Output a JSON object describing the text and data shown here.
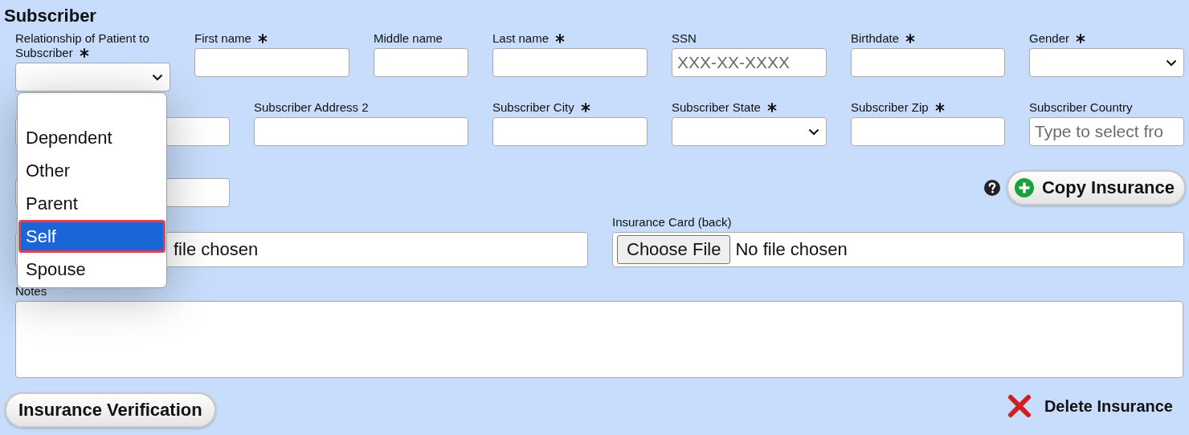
{
  "section_title": "Subscriber",
  "rows": [
    {
      "fields": [
        {
          "kind": "select",
          "label": "Relationship of Patient to Subscriber",
          "required": true,
          "expanded": true,
          "options": [
            {
              "kind": "option",
              "label": "Dependent",
              "selected": false
            },
            {
              "kind": "option",
              "label": "Other",
              "selected": false
            },
            {
              "kind": "option",
              "label": "Parent",
              "selected": false
            },
            {
              "kind": "option",
              "label": "Self",
              "selected": true
            },
            {
              "kind": "option",
              "label": "Spouse",
              "selected": false
            }
          ]
        },
        {
          "kind": "text",
          "label": "First name",
          "required": true
        },
        {
          "kind": "text",
          "label": "Middle name",
          "required": false
        },
        {
          "kind": "text",
          "label": "Last name",
          "required": true
        },
        {
          "kind": "text",
          "label": "SSN",
          "required": false,
          "placeholder": "XXX-XX-XXXX"
        },
        {
          "kind": "text",
          "label": "Birthdate",
          "required": true
        },
        {
          "kind": "select",
          "label": "Gender",
          "required": true,
          "expanded": false
        }
      ]
    },
    {
      "fields": [
        {
          "kind": "text"
        },
        {
          "kind": "text",
          "label": "Subscriber Address 2",
          "required": false
        },
        {
          "kind": "text",
          "label": "Subscriber City",
          "required": true
        },
        {
          "kind": "select",
          "label": "Subscriber State",
          "required": true,
          "expanded": false
        },
        {
          "kind": "text",
          "label": "Subscriber Zip",
          "required": true
        },
        {
          "kind": "text",
          "label": "Subscriber Country",
          "required": false,
          "placeholder": "Type to select fro"
        }
      ]
    },
    {
      "fields": [
        {
          "kind": "text"
        }
      ]
    }
  ],
  "copy_button": {
    "label": "Copy Insurance"
  },
  "file_fields": [
    {
      "status": "file chosen"
    },
    {
      "label": "Insurance Card (back)",
      "button": "Choose File",
      "status": "No file chosen"
    }
  ],
  "notes": {
    "label": "Notes"
  },
  "verification_button": {
    "label": "Insurance Verification"
  },
  "delete_button": {
    "label": "Delete Insurance"
  }
}
